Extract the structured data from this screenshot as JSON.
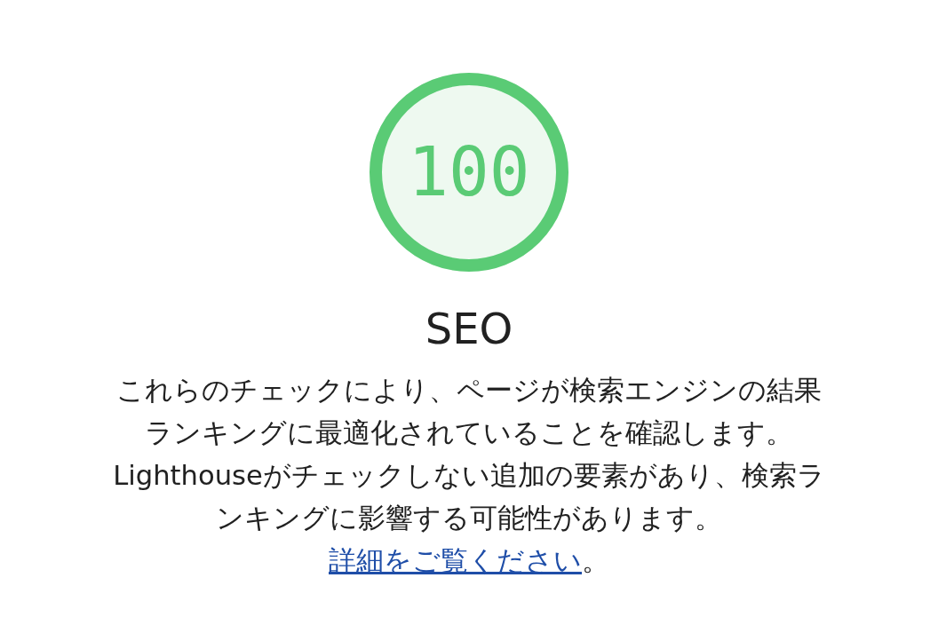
{
  "gauge": {
    "score": "100",
    "level": 1
  },
  "category_title": "SEO",
  "description": {
    "text": "これらのチェックにより、ページが検索エンジンの結果ランキングに最適化されていることを確認します。Lighthouseがチェックしない追加の要素があり、検索ランキングに影響する可能性があります。",
    "link": "詳細をご覧ください",
    "trailing": "。"
  }
}
